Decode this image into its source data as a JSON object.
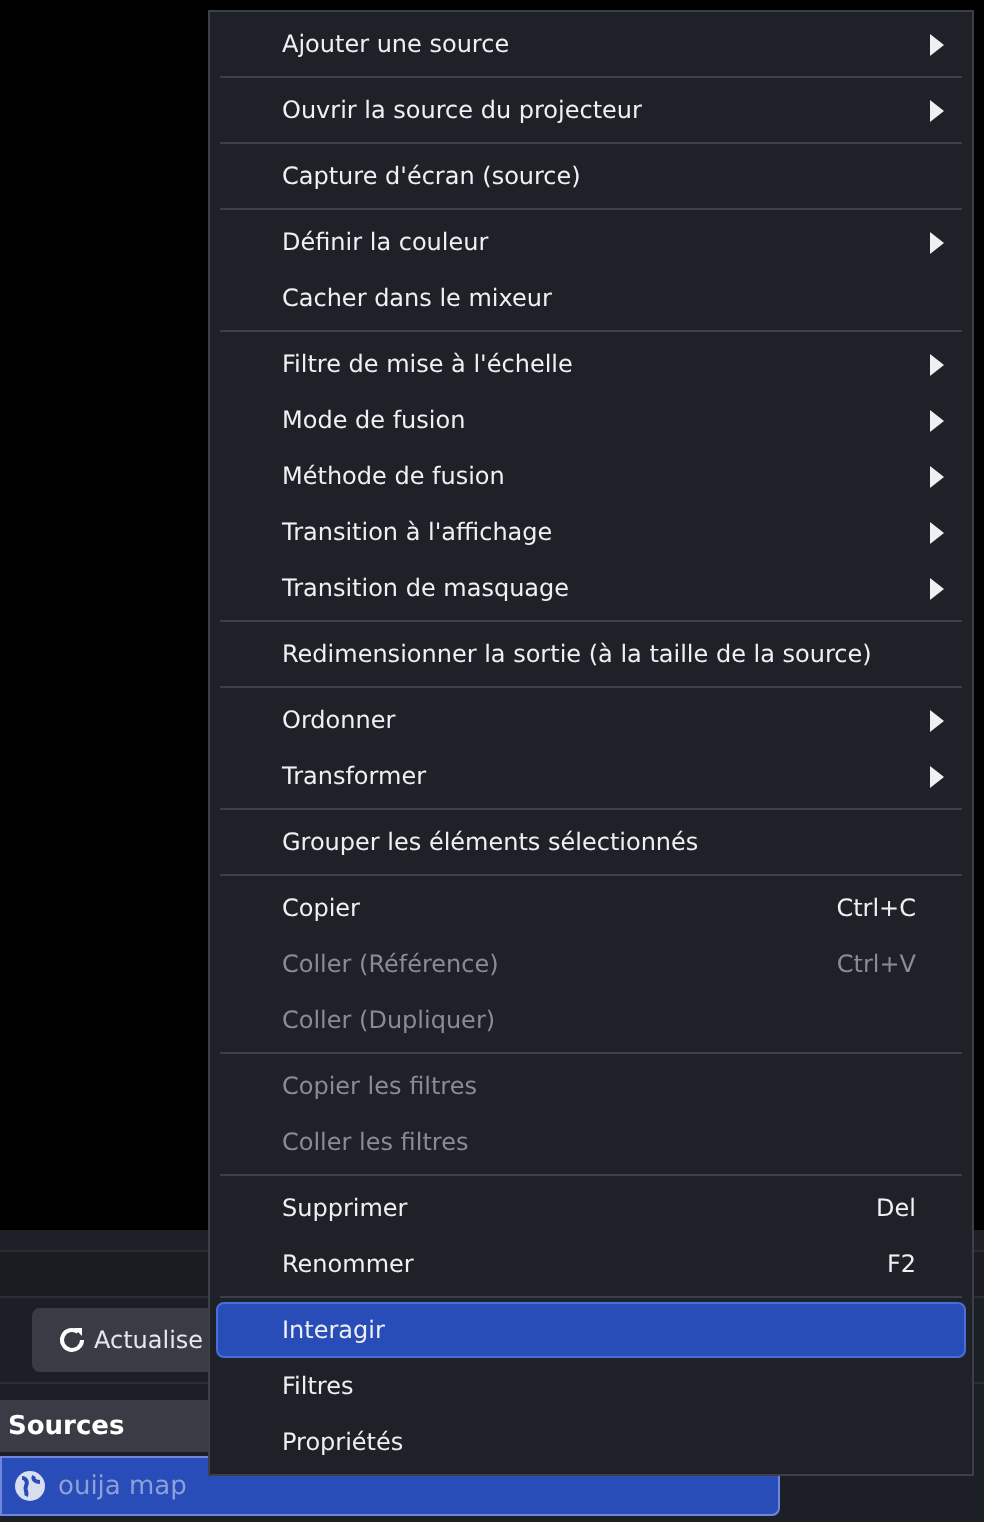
{
  "toolbar": {
    "refresh_button": "Actualise"
  },
  "sources": {
    "title": "Sources",
    "items": [
      {
        "name": "ouija map",
        "selected": true
      }
    ]
  },
  "context_menu": {
    "groups": [
      {
        "items": [
          {
            "label": "Ajouter une source",
            "submenu": true,
            "disabled": false,
            "selected": false
          }
        ]
      },
      {
        "items": [
          {
            "label": "Ouvrir la source du projecteur",
            "submenu": true,
            "disabled": false,
            "selected": false
          }
        ]
      },
      {
        "items": [
          {
            "label": "Capture d'écran (source)",
            "submenu": false,
            "disabled": false,
            "selected": false
          }
        ]
      },
      {
        "items": [
          {
            "label": "Définir la couleur",
            "submenu": true,
            "disabled": false,
            "selected": false
          },
          {
            "label": "Cacher dans le mixeur",
            "submenu": false,
            "disabled": false,
            "selected": false
          }
        ]
      },
      {
        "items": [
          {
            "label": "Filtre de mise à l'échelle",
            "submenu": true,
            "disabled": false,
            "selected": false
          },
          {
            "label": "Mode de fusion",
            "submenu": true,
            "disabled": false,
            "selected": false
          },
          {
            "label": "Méthode de fusion",
            "submenu": true,
            "disabled": false,
            "selected": false
          },
          {
            "label": "Transition à l'affichage",
            "submenu": true,
            "disabled": false,
            "selected": false
          },
          {
            "label": "Transition de masquage",
            "submenu": true,
            "disabled": false,
            "selected": false
          }
        ]
      },
      {
        "items": [
          {
            "label": "Redimensionner la sortie (à la taille de la source)",
            "submenu": false,
            "disabled": false,
            "selected": false
          }
        ]
      },
      {
        "items": [
          {
            "label": "Ordonner",
            "submenu": true,
            "disabled": false,
            "selected": false
          },
          {
            "label": "Transformer",
            "submenu": true,
            "disabled": false,
            "selected": false
          }
        ]
      },
      {
        "items": [
          {
            "label": "Grouper les éléments sélectionnés",
            "submenu": false,
            "disabled": false,
            "selected": false
          }
        ]
      },
      {
        "items": [
          {
            "label": "Copier",
            "shortcut": "Ctrl+C",
            "submenu": false,
            "disabled": false,
            "selected": false
          },
          {
            "label": "Coller (Référence)",
            "shortcut": "Ctrl+V",
            "submenu": false,
            "disabled": true,
            "selected": false
          },
          {
            "label": "Coller (Dupliquer)",
            "submenu": false,
            "disabled": true,
            "selected": false
          }
        ]
      },
      {
        "items": [
          {
            "label": "Copier les filtres",
            "submenu": false,
            "disabled": true,
            "selected": false
          },
          {
            "label": "Coller les filtres",
            "submenu": false,
            "disabled": true,
            "selected": false
          }
        ]
      },
      {
        "items": [
          {
            "label": "Supprimer",
            "shortcut": "Del",
            "submenu": false,
            "disabled": false,
            "selected": false
          },
          {
            "label": "Renommer",
            "shortcut": "F2",
            "submenu": false,
            "disabled": false,
            "selected": false
          }
        ]
      },
      {
        "items": [
          {
            "label": "Interagir",
            "submenu": false,
            "disabled": false,
            "selected": true
          },
          {
            "label": "Filtres",
            "submenu": false,
            "disabled": false,
            "selected": false
          },
          {
            "label": "Propriétés",
            "submenu": false,
            "disabled": false,
            "selected": false
          }
        ]
      }
    ]
  }
}
